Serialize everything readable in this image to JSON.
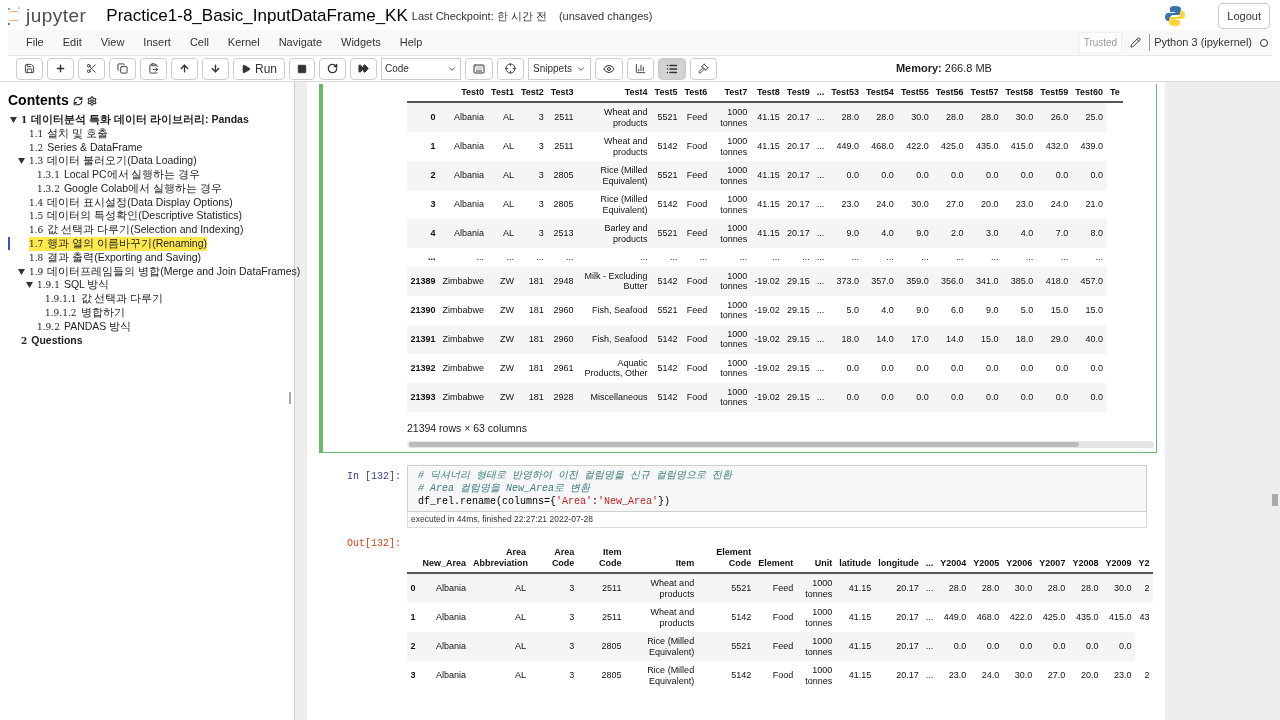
{
  "header": {
    "logo": "jupyter",
    "notebook_title": "Practice1-8_Basic_InputDataFrame_KK",
    "checkpoint": "Last Checkpoint: 한 시간 전",
    "unsaved": "(unsaved changes)",
    "logout": "Logout"
  },
  "menu": [
    "File",
    "Edit",
    "View",
    "Insert",
    "Cell",
    "Kernel",
    "Navigate",
    "Widgets",
    "Help"
  ],
  "kernel": {
    "trusted": "Trusted",
    "name": "Python 3 (ipykernel)",
    "busy": false
  },
  "toolbar": {
    "run": "Run",
    "cell_type": "Code",
    "snippets": "Snippets",
    "toc_active": true
  },
  "memory": "**Memory:** 266.8 MB",
  "toc": {
    "title": "Contents",
    "items": [
      {
        "num": "1",
        "label": "데이터분석 특화 데이터 라이브러리: Pandas",
        "bold": true,
        "expanded": true,
        "selected": false,
        "children": [
          {
            "num": "1.1",
            "label": "설치 및 호출",
            "selected": false
          },
          {
            "num": "1.2",
            "label": "Series & DataFrame",
            "selected": false
          },
          {
            "num": "1.3",
            "label": "데이터 불러오기(Data Loading)",
            "expanded": true,
            "selected": false,
            "children": [
              {
                "num": "1.3.1",
                "label": "Local PC에서 실행하는 경우",
                "selected": false
              },
              {
                "num": "1.3.2",
                "label": "Google Colab에서 실행하는 경우",
                "selected": false
              }
            ]
          },
          {
            "num": "1.4",
            "label": "데이터 표시설정(Data Display Options)",
            "selected": false
          },
          {
            "num": "1.5",
            "label": "데이터의 특성확인(Descriptive Statistics)",
            "selected": false
          },
          {
            "num": "1.6",
            "label": "값 선택과 다루기(Selection and Indexing)",
            "selected": false
          },
          {
            "num": "1.7",
            "label": "행과 열의 이름바꾸기(Renaming)",
            "selected": true
          },
          {
            "num": "1.8",
            "label": "결과 출력(Exporting and Saving)",
            "selected": false
          },
          {
            "num": "1.9",
            "label": "데이터프레임들의 병합(Merge and Join DataFrames)",
            "expanded": true,
            "selected": false,
            "children": [
              {
                "num": "1.9.1",
                "label": "SQL 방식",
                "expanded": true,
                "selected": false,
                "children": [
                  {
                    "num": "1.9.1.1",
                    "label": "값 선택과 다루기",
                    "selected": false
                  },
                  {
                    "num": "1.9.1.2",
                    "label": "병합하기",
                    "selected": false
                  }
                ]
              },
              {
                "num": "1.9.2",
                "label": "PANDAS 방식",
                "selected": false
              }
            ]
          }
        ]
      },
      {
        "num": "2",
        "label": "Questions",
        "bold": true,
        "selected": false
      }
    ]
  },
  "output1": {
    "columns": [
      "",
      "Test0",
      "Test1",
      "Test2",
      "Test3",
      "Test4",
      "Test5",
      "Test6",
      "Test7",
      "Test8",
      "Test9",
      "...",
      "Test53",
      "Test54",
      "Test55",
      "Test56",
      "Test57",
      "Test58",
      "Test59",
      "Test60",
      "Te"
    ],
    "rows": [
      [
        "0",
        "Albania",
        "AL",
        "3",
        "2511",
        "Wheat and products",
        "5521",
        "Feed",
        "1000 tonnes",
        "41.15",
        "20.17",
        "...",
        "28.0",
        "28.0",
        "30.0",
        "28.0",
        "28.0",
        "30.0",
        "26.0",
        "25.0"
      ],
      [
        "1",
        "Albania",
        "AL",
        "3",
        "2511",
        "Wheat and products",
        "5142",
        "Food",
        "1000 tonnes",
        "41.15",
        "20.17",
        "...",
        "449.0",
        "468.0",
        "422.0",
        "425.0",
        "435.0",
        "415.0",
        "432.0",
        "439.0"
      ],
      [
        "2",
        "Albania",
        "AL",
        "3",
        "2805",
        "Rice (Milled Equivalent)",
        "5521",
        "Feed",
        "1000 tonnes",
        "41.15",
        "20.17",
        "...",
        "0.0",
        "0.0",
        "0.0",
        "0.0",
        "0.0",
        "0.0",
        "0.0",
        "0.0"
      ],
      [
        "3",
        "Albania",
        "AL",
        "3",
        "2805",
        "Rice (Milled Equivalent)",
        "5142",
        "Food",
        "1000 tonnes",
        "41.15",
        "20.17",
        "...",
        "23.0",
        "24.0",
        "30.0",
        "27.0",
        "20.0",
        "23.0",
        "24.0",
        "21.0"
      ],
      [
        "4",
        "Albania",
        "AL",
        "3",
        "2513",
        "Barley and products",
        "5521",
        "Feed",
        "1000 tonnes",
        "41.15",
        "20.17",
        "...",
        "9.0",
        "4.0",
        "9.0",
        "2.0",
        "3.0",
        "4.0",
        "7.0",
        "8.0"
      ],
      [
        "...",
        "...",
        "...",
        "...",
        "...",
        "...",
        "...",
        "...",
        "...",
        "...",
        "...",
        "...",
        "...",
        "...",
        "...",
        "...",
        "...",
        "...",
        "...",
        "..."
      ],
      [
        "21389",
        "Zimbabwe",
        "ZW",
        "181",
        "2948",
        "Milk - Excluding Butter",
        "5142",
        "Food",
        "1000 tonnes",
        "-19.02",
        "29.15",
        "...",
        "373.0",
        "357.0",
        "359.0",
        "356.0",
        "341.0",
        "385.0",
        "418.0",
        "457.0"
      ],
      [
        "21390",
        "Zimbabwe",
        "ZW",
        "181",
        "2960",
        "Fish, Seafood",
        "5521",
        "Feed",
        "1000 tonnes",
        "-19.02",
        "29.15",
        "...",
        "5.0",
        "4.0",
        "9.0",
        "6.0",
        "9.0",
        "5.0",
        "15.0",
        "15.0"
      ],
      [
        "21391",
        "Zimbabwe",
        "ZW",
        "181",
        "2960",
        "Fish, Seafood",
        "5142",
        "Food",
        "1000 tonnes",
        "-19.02",
        "29.15",
        "...",
        "18.0",
        "14.0",
        "17.0",
        "14.0",
        "15.0",
        "18.0",
        "29.0",
        "40.0"
      ],
      [
        "21392",
        "Zimbabwe",
        "ZW",
        "181",
        "2961",
        "Aquatic Products, Other",
        "5142",
        "Food",
        "1000 tonnes",
        "-19.02",
        "29.15",
        "...",
        "0.0",
        "0.0",
        "0.0",
        "0.0",
        "0.0",
        "0.0",
        "0.0",
        "0.0"
      ],
      [
        "21393",
        "Zimbabwe",
        "ZW",
        "181",
        "2928",
        "Miscellaneous",
        "5142",
        "Food",
        "1000 tonnes",
        "-19.02",
        "29.15",
        "...",
        "0.0",
        "0.0",
        "0.0",
        "0.0",
        "0.0",
        "0.0",
        "0.0",
        "0.0"
      ]
    ],
    "shape": "21394 rows × 63 columns"
  },
  "cell": {
    "prompt": "In [132]:",
    "lines": [
      [
        {
          "kind": "comment",
          "text": "# 딕셔너리 형태로 반영하여 이전 컬럼명을 신규 컬럼명으로 전환"
        }
      ],
      [
        {
          "kind": "comment",
          "text": "# Area 컬럼명을 New_Area로 변환"
        }
      ],
      [
        {
          "kind": "plain",
          "text": "df_rel.rename(columns={"
        },
        {
          "kind": "string",
          "text": "'Area'"
        },
        {
          "kind": "plain",
          "text": ":"
        },
        {
          "kind": "string",
          "text": "'New_Area'"
        },
        {
          "kind": "plain",
          "text": "})"
        }
      ]
    ],
    "executed": "executed in 44ms, finished 22:27:21 2022-07-28"
  },
  "output2": {
    "prompt": "Out[132]:",
    "columns": [
      "",
      "New_Area",
      "Area Abbreviation",
      "Area Code",
      "Item Code",
      "Item",
      "Element Code",
      "Element",
      "Unit",
      "latitude",
      "longitude",
      "...",
      "Y2004",
      "Y2005",
      "Y2006",
      "Y2007",
      "Y2008",
      "Y2009",
      "Y2"
    ],
    "rows": [
      [
        "0",
        "Albania",
        "AL",
        "3",
        "2511",
        "Wheat and products",
        "5521",
        "Feed",
        "1000 tonnes",
        "41.15",
        "20.17",
        "...",
        "28.0",
        "28.0",
        "30.0",
        "28.0",
        "28.0",
        "30.0",
        "2"
      ],
      [
        "1",
        "Albania",
        "AL",
        "3",
        "2511",
        "Wheat and products",
        "5142",
        "Food",
        "1000 tonnes",
        "41.15",
        "20.17",
        "...",
        "449.0",
        "468.0",
        "422.0",
        "425.0",
        "435.0",
        "415.0",
        "43"
      ],
      [
        "2",
        "Albania",
        "AL",
        "3",
        "2805",
        "Rice (Milled Equivalent)",
        "5521",
        "Feed",
        "1000 tonnes",
        "41.15",
        "20.17",
        "...",
        "0.0",
        "0.0",
        "0.0",
        "0.0",
        "0.0",
        "0.0"
      ],
      [
        "3",
        "Albania",
        "AL",
        "3",
        "2805",
        "Rice (Milled Equivalent)",
        "5142",
        "Food",
        "1000 tonnes",
        "41.15",
        "20.17",
        "...",
        "23.0",
        "24.0",
        "30.0",
        "27.0",
        "20.0",
        "23.0",
        "2"
      ]
    ]
  }
}
